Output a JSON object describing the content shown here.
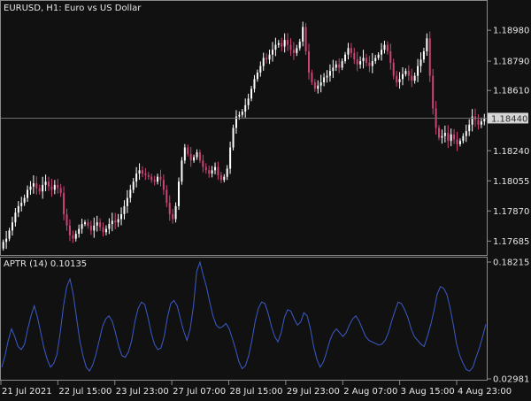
{
  "main_chart": {
    "header": "EURUSD, H1:  Euro vs US Dollar",
    "current_price_label": "1.18440",
    "price_tick_labels": [
      "1.18980",
      "1.18790",
      "1.18610",
      "1.18440",
      "1.18240",
      "1.18055",
      "1.17870",
      "1.17685"
    ],
    "colors": {
      "background": "#111111",
      "bull_candle": "#ffffff",
      "bear_candle": "#cc4477",
      "grid": "#2a2a2a",
      "price_line": "#6e6e6e",
      "badge_bg": "#d6d6d6",
      "badge_text": "#2f2f2f"
    }
  },
  "indicator": {
    "header": "APTR (14) 0.10135",
    "tick_labels": [
      "0.18215",
      "0.02981"
    ],
    "line_color": "#3c5bc8"
  },
  "time_axis_labels": [
    "21 Jul 2021",
    "22 Jul 15:00",
    "23 Jul 23:00",
    "27 Jul 07:00",
    "28 Jul 15:00",
    "29 Jul 23:00",
    "2 Aug 07:00",
    "3 Aug 15:00",
    "4 Aug 23:00"
  ],
  "chart_data": [
    {
      "type": "candlestick",
      "title": "EURUSD, H1:  Euro vs US Dollar",
      "ylim": [
        1.176,
        1.1916
      ],
      "y_ticks": [
        1.1898,
        1.1879,
        1.1861,
        1.1844,
        1.1824,
        1.18055,
        1.1787,
        1.17685
      ],
      "current_price": 1.1844,
      "close_path": [
        1.1768,
        1.177,
        1.1775,
        1.178,
        1.1786,
        1.179,
        1.1792,
        1.1795,
        1.18,
        1.1802,
        1.1804,
        1.1801,
        1.1799,
        1.1803,
        1.1805,
        1.1802,
        1.18,
        1.1803,
        1.1801,
        1.1798,
        1.1785,
        1.1778,
        1.1772,
        1.177,
        1.1773,
        1.1776,
        1.1779,
        1.178,
        1.1778,
        1.1775,
        1.1778,
        1.178,
        1.1777,
        1.1774,
        1.1776,
        1.1779,
        1.1781,
        1.178,
        1.1782,
        1.1785,
        1.179,
        1.1795,
        1.18,
        1.1805,
        1.181,
        1.1812,
        1.181,
        1.1809,
        1.1808,
        1.1806,
        1.1805,
        1.1808,
        1.1806,
        1.18,
        1.1792,
        1.1785,
        1.1782,
        1.179,
        1.1805,
        1.1818,
        1.1826,
        1.1822,
        1.1818,
        1.182,
        1.1823,
        1.1818,
        1.1814,
        1.1812,
        1.181,
        1.1812,
        1.1814,
        1.1809,
        1.1806,
        1.1808,
        1.1813,
        1.1826,
        1.1838,
        1.1845,
        1.1846,
        1.1848,
        1.1852,
        1.1856,
        1.1862,
        1.1868,
        1.1872,
        1.1876,
        1.1881,
        1.188,
        1.1883,
        1.1886,
        1.1889,
        1.189,
        1.1888,
        1.1892,
        1.1889,
        1.1886,
        1.1884,
        1.1887,
        1.1891,
        1.19,
        1.1885,
        1.1872,
        1.1866,
        1.1862,
        1.1864,
        1.1866,
        1.1869,
        1.187,
        1.1873,
        1.1875,
        1.1877,
        1.1875,
        1.1879,
        1.1883,
        1.1887,
        1.1884,
        1.188,
        1.1877,
        1.1879,
        1.1881,
        1.1878,
        1.1876,
        1.1879,
        1.1881,
        1.1883,
        1.1886,
        1.1889,
        1.1885,
        1.1878,
        1.187,
        1.1866,
        1.1868,
        1.1871,
        1.1873,
        1.187,
        1.1867,
        1.187,
        1.1876,
        1.188,
        1.1885,
        1.1893,
        1.187,
        1.185,
        1.1838,
        1.1832,
        1.1833,
        1.1835,
        1.183,
        1.1834,
        1.1831,
        1.1828,
        1.183,
        1.1833,
        1.1836,
        1.184,
        1.1845,
        1.1843,
        1.184,
        1.1842,
        1.1844
      ]
    },
    {
      "type": "line",
      "title": "APTR (14) 0.10135",
      "ylim": [
        0.02981,
        0.18215
      ],
      "y_ticks": [
        0.18215,
        0.02981
      ],
      "values": [
        0.045,
        0.06,
        0.08,
        0.095,
        0.085,
        0.072,
        0.068,
        0.075,
        0.095,
        0.112,
        0.125,
        0.11,
        0.09,
        0.07,
        0.055,
        0.045,
        0.05,
        0.062,
        0.09,
        0.125,
        0.15,
        0.16,
        0.14,
        0.11,
        0.08,
        0.06,
        0.045,
        0.04,
        0.048,
        0.062,
        0.08,
        0.098,
        0.108,
        0.112,
        0.105,
        0.09,
        0.072,
        0.06,
        0.058,
        0.065,
        0.08,
        0.105,
        0.122,
        0.13,
        0.127,
        0.11,
        0.09,
        0.075,
        0.068,
        0.07,
        0.085,
        0.11,
        0.128,
        0.132,
        0.125,
        0.108,
        0.092,
        0.08,
        0.095,
        0.125,
        0.17,
        0.182,
        0.165,
        0.15,
        0.13,
        0.112,
        0.1,
        0.096,
        0.098,
        0.102,
        0.095,
        0.082,
        0.068,
        0.052,
        0.043,
        0.047,
        0.06,
        0.08,
        0.105,
        0.122,
        0.13,
        0.128,
        0.115,
        0.098,
        0.085,
        0.078,
        0.09,
        0.11,
        0.12,
        0.118,
        0.108,
        0.1,
        0.104,
        0.116,
        0.112,
        0.095,
        0.072,
        0.055,
        0.045,
        0.052,
        0.065,
        0.08,
        0.09,
        0.095,
        0.09,
        0.085,
        0.09,
        0.1,
        0.108,
        0.112,
        0.105,
        0.095,
        0.085,
        0.08,
        0.078,
        0.076,
        0.074,
        0.075,
        0.08,
        0.09,
        0.105,
        0.118,
        0.13,
        0.128,
        0.12,
        0.11,
        0.095,
        0.085,
        0.08,
        0.075,
        0.072,
        0.085,
        0.1,
        0.118,
        0.14,
        0.15,
        0.148,
        0.14,
        0.122,
        0.1,
        0.075,
        0.06,
        0.05,
        0.042,
        0.04,
        0.045,
        0.058,
        0.07,
        0.085,
        0.101
      ]
    }
  ]
}
